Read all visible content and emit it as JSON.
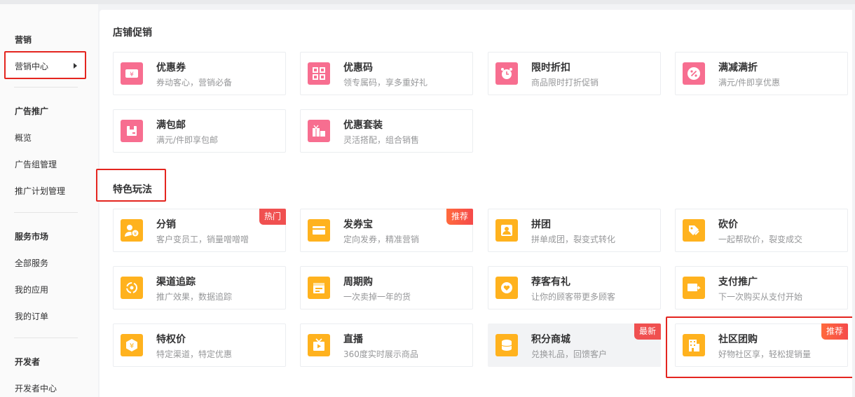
{
  "sidebar": {
    "marketing_title": "营销",
    "marketing_center": "营销中心",
    "ads_title": "广告推广",
    "ads_items": [
      "概览",
      "广告组管理",
      "推广计划管理"
    ],
    "service_title": "服务市场",
    "service_items": [
      "全部服务",
      "我的应用",
      "我的订单"
    ],
    "dev_title": "开发者",
    "dev_items": [
      "开发者中心"
    ]
  },
  "sections": {
    "store_promo": "店铺促销",
    "featured": "特色玩法"
  },
  "store_cards": [
    {
      "title": "优惠券",
      "desc": "券动客心，营销必备",
      "icon": "ticket-yen-icon"
    },
    {
      "title": "优惠码",
      "desc": "领专属码，享多重好礼",
      "icon": "qr-code-icon"
    },
    {
      "title": "限时折扣",
      "desc": "商品限时打折促销",
      "icon": "alarm-clock-icon"
    },
    {
      "title": "满减满折",
      "desc": "满元/件即享优惠",
      "icon": "percent-icon"
    },
    {
      "title": "满包邮",
      "desc": "满元/件即享包邮",
      "icon": "parcel-box-icon"
    },
    {
      "title": "优惠套装",
      "desc": "灵活搭配，组合销售",
      "icon": "gift-bundle-icon"
    }
  ],
  "featured_cards": [
    {
      "title": "分销",
      "desc": "客户变员工，销量噌噌噌",
      "badge": "热门",
      "icon": "user-yen-icon"
    },
    {
      "title": "发券宝",
      "desc": "定向发券，精准营销",
      "badge": "推荐",
      "icon": "wallet-icon"
    },
    {
      "title": "拼团",
      "desc": "拼单成团，裂变式转化",
      "icon": "group-users-icon"
    },
    {
      "title": "砍价",
      "desc": "一起帮砍价，裂变成交",
      "icon": "knife-tag-icon"
    },
    {
      "title": "渠道追踪",
      "desc": "推广效果，数据追踪",
      "icon": "tracking-cycle-icon"
    },
    {
      "title": "周期购",
      "desc": "一次卖掉一年的货",
      "icon": "calendar-icon"
    },
    {
      "title": "荐客有礼",
      "desc": "让你的顾客带更多顾客",
      "icon": "heart-badge-icon"
    },
    {
      "title": "支付推广",
      "desc": "下一次购买从支付开始",
      "icon": "payment-card-icon"
    },
    {
      "title": "特权价",
      "desc": "特定渠道，特定优惠",
      "icon": "yen-hexagon-icon"
    },
    {
      "title": "直播",
      "desc": "360度实时展示商品",
      "icon": "tv-play-icon"
    },
    {
      "title": "积分商城",
      "desc": "兑换礼品，回馈客户",
      "badge": "最新",
      "icon": "coins-stack-icon"
    },
    {
      "title": "社区团购",
      "desc": "好物社区享，轻松提销量",
      "badge": "推荐",
      "icon": "building-icon"
    }
  ],
  "colors": {
    "accent_pink": "#f76e90",
    "accent_orange": "#ffb21e",
    "highlight_red": "#e4251f"
  }
}
